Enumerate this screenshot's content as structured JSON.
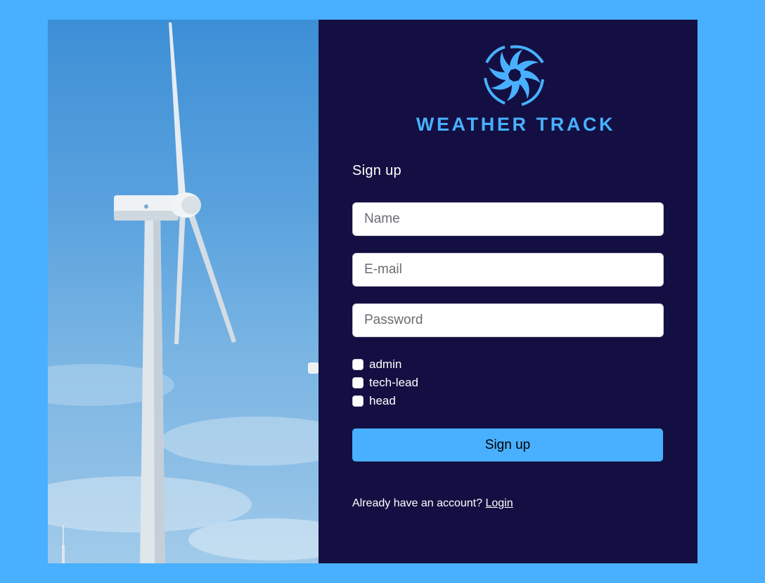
{
  "brand": {
    "name": "WEATHER TRACK",
    "color": "#48b0ff"
  },
  "theme": {
    "page_background": "#48b0ff",
    "panel_background": "#130f42",
    "accent": "#48b0ff"
  },
  "photo": {
    "subject": "wind-turbine"
  },
  "form": {
    "heading": "Sign up",
    "name_placeholder": "Name",
    "email_placeholder": "E-mail",
    "password_placeholder": "Password",
    "roles": [
      {
        "label": "admin",
        "checked": false
      },
      {
        "label": "tech-lead",
        "checked": false
      },
      {
        "label": "head",
        "checked": false
      }
    ],
    "submit_label": "Sign up"
  },
  "footer": {
    "prompt": "Already have an account? ",
    "login_label": "Login"
  }
}
